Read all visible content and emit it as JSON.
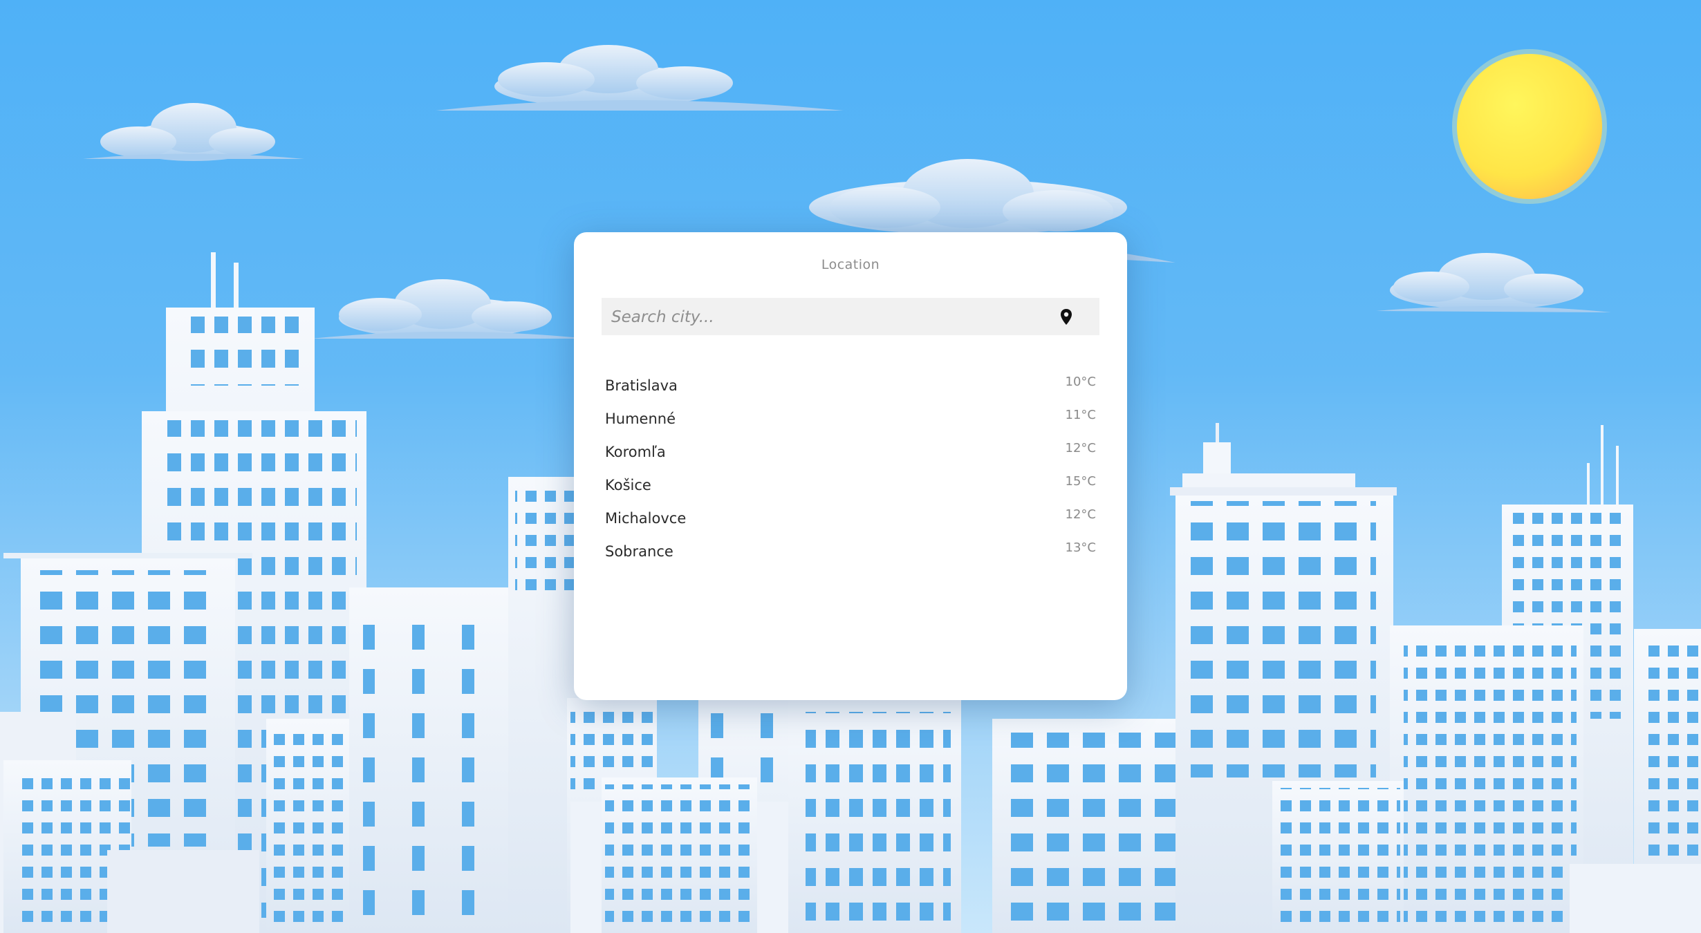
{
  "panel": {
    "title": "Location",
    "search": {
      "placeholder": "Search city...",
      "value": ""
    },
    "cities": [
      {
        "name": "Bratislava",
        "temp": "10°C"
      },
      {
        "name": "Humenné",
        "temp": "11°C"
      },
      {
        "name": "Koromľa",
        "temp": "12°C"
      },
      {
        "name": "Košice",
        "temp": "15°C"
      },
      {
        "name": "Michalovce",
        "temp": "12°C"
      },
      {
        "name": "Sobrance",
        "temp": "13°C"
      }
    ]
  },
  "colors": {
    "sky_top": "#4fb1f7",
    "sky_bottom": "#c9e7fb",
    "sun": "#ffe34d",
    "window": "#5aaeea",
    "building": "#eef3fa"
  }
}
